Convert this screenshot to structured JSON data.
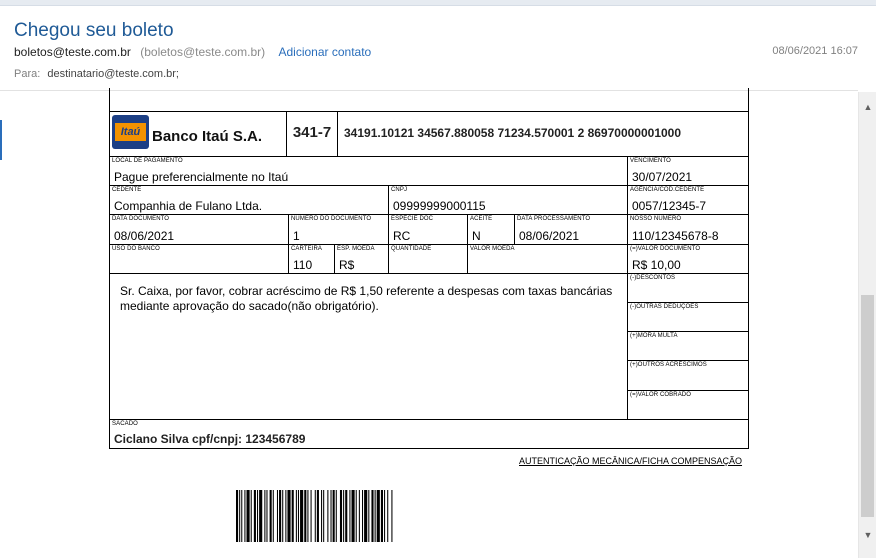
{
  "email": {
    "subject": "Chegou seu boleto",
    "sender_name": "boletos@teste.com.br",
    "sender_email": "(boletos@teste.com.br)",
    "add_contact": "Adicionar contato",
    "date": "08/06/2021 16:07",
    "to_label": "Para:",
    "to_value": "destinatario@teste.com.br;"
  },
  "boleto": {
    "bank_logo_text": "Itaú",
    "bank_name": "Banco Itaú S.A.",
    "bank_code": "341-7",
    "digit_line": "34191.10121 34567.880058 71234.570001 2 86970000001000",
    "local_pagamento": {
      "label": "LOCAL DE PAGAMENTO",
      "value": "Pague preferencialmente no Itaú"
    },
    "vencimento": {
      "label": "VENCIMENTO",
      "value": "30/07/2021"
    },
    "cedente": {
      "label": "CEDENTE",
      "value": "Companhia de Fulano Ltda."
    },
    "cnpj": {
      "label": "CNPJ",
      "value": "09999999000115"
    },
    "agencia": {
      "label": "AGÊNCIA/CÓD.CEDENTE",
      "value": "0057/12345-7"
    },
    "data_documento": {
      "label": "DATA DOCUMENTO",
      "value": "08/06/2021"
    },
    "numero_documento": {
      "label": "NÚMERO DO DOCUMENTO",
      "value": "1"
    },
    "especie_doc": {
      "label": "ESPÉCIE DOC",
      "value": "RC"
    },
    "aceite": {
      "label": "ACEITE",
      "value": "N"
    },
    "data_processamento": {
      "label": "DATA PROCESSAMENTO",
      "value": "08/06/2021"
    },
    "nosso_numero": {
      "label": "NOSSO NÚMERO",
      "value": "110/12345678-8"
    },
    "uso_banco": {
      "label": "USO DO BANCO",
      "value": ""
    },
    "carteira": {
      "label": "CARTEIRA",
      "value": "110"
    },
    "esp_moeda": {
      "label": "ESP. MOEDA",
      "value": "R$"
    },
    "quantidade": {
      "label": "QUANTIDADE",
      "value": ""
    },
    "valor_moeda": {
      "label": "VALOR MOEDA",
      "value": ""
    },
    "valor_documento": {
      "label": "(=)VALOR DOCUMENTO",
      "value": "R$ 10,00"
    },
    "instructions": "Sr. Caixa, por favor, cobrar acréscimo de R$ 1,50 referente a despesas com taxas bancárias mediante aprovação do sacado(não obrigatório).",
    "descontos_label": "(-)DESCONTOS",
    "outras_deducoes_label": "(-)OUTRAS DEDUÇÕES",
    "mora_multa_label": "(+)MORA MULTA",
    "outros_acrescimos_label": "(+)OUTROS ACRÉSCIMOS",
    "valor_cobrado_label": "(=)VALOR COBRADO",
    "sacado": {
      "label": "SACADO",
      "value": "Ciclano Silva cpf/cnpj: 123456789"
    },
    "autenticacao": "AUTENTICAÇÃO MECÂNICA/FICHA COMPENSAÇÃO"
  },
  "icons": {
    "scroll_up": "chevron-up-icon",
    "scroll_down": "chevron-down-icon",
    "bank_logo": "itau-logo-icon"
  }
}
